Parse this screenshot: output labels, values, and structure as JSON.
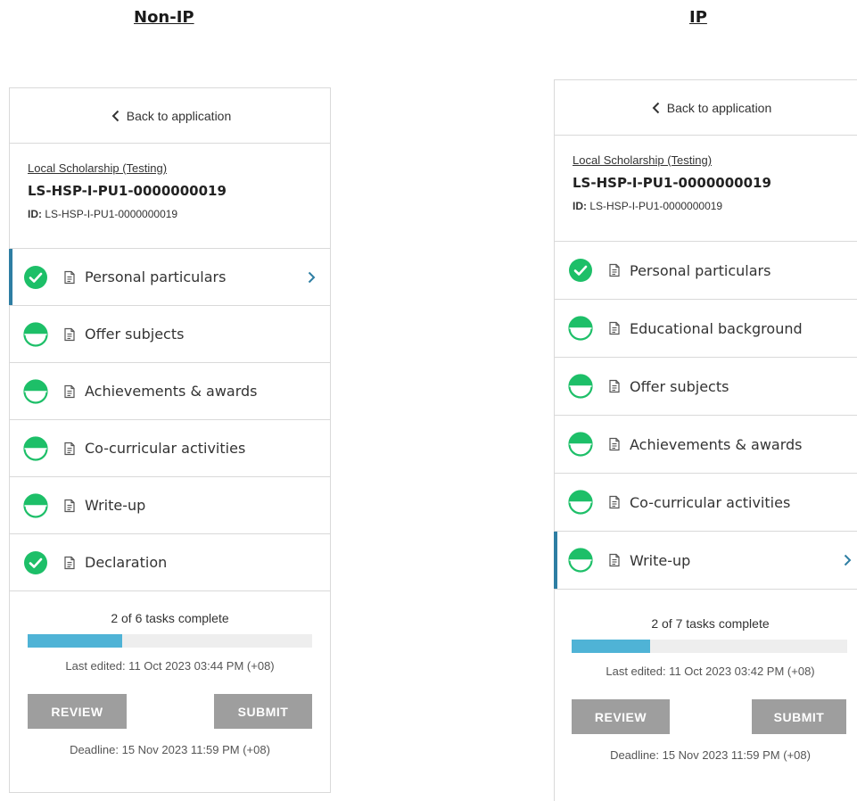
{
  "headings": {
    "left": "Non-IP",
    "right": "IP"
  },
  "colors": {
    "complete": "#1dbf68",
    "active_border": "#2e7ea3",
    "progress_fill": "#4fb3d6",
    "button_bg": "#9e9e9e"
  },
  "panels": {
    "left": {
      "back_label": "Back to application",
      "scheme": "Local Scholarship (Testing)",
      "ref_no": "LS-HSP-I-PU1-0000000019",
      "id_label": "ID:",
      "id_value": "LS-HSP-I-PU1-0000000019",
      "tasks": [
        {
          "label": "Personal particulars",
          "status": "complete",
          "active": true
        },
        {
          "label": "Offer subjects",
          "status": "in-progress",
          "active": false
        },
        {
          "label": "Achievements & awards",
          "status": "in-progress",
          "active": false
        },
        {
          "label": "Co-curricular activities",
          "status": "in-progress",
          "active": false
        },
        {
          "label": "Write-up",
          "status": "in-progress",
          "active": false
        },
        {
          "label": "Declaration",
          "status": "complete",
          "active": false
        }
      ],
      "progress_text": "2 of 6 tasks complete",
      "progress_fraction": 0.333,
      "last_edited": "Last edited: 11 Oct 2023 03:44 PM (+08)",
      "review_label": "REVIEW",
      "submit_label": "SUBMIT",
      "deadline": "Deadline: 15 Nov 2023 11:59 PM (+08)"
    },
    "right": {
      "back_label": "Back to application",
      "scheme": "Local Scholarship (Testing)",
      "ref_no": "LS-HSP-I-PU1-0000000019",
      "id_label": "ID:",
      "id_value": "LS-HSP-I-PU1-0000000019",
      "tasks": [
        {
          "label": "Personal particulars",
          "status": "complete",
          "active": false
        },
        {
          "label": "Educational background",
          "status": "in-progress",
          "active": false
        },
        {
          "label": "Offer subjects",
          "status": "in-progress",
          "active": false
        },
        {
          "label": "Achievements & awards",
          "status": "in-progress",
          "active": false
        },
        {
          "label": "Co-curricular activities",
          "status": "in-progress",
          "active": false
        },
        {
          "label": "Write-up",
          "status": "in-progress",
          "active": true
        }
      ],
      "progress_text": "2 of 7 tasks complete",
      "progress_fraction": 0.286,
      "last_edited": "Last edited: 11 Oct 2023 03:42 PM (+08)",
      "review_label": "REVIEW",
      "submit_label": "SUBMIT",
      "deadline": "Deadline: 15 Nov 2023 11:59 PM (+08)"
    }
  }
}
